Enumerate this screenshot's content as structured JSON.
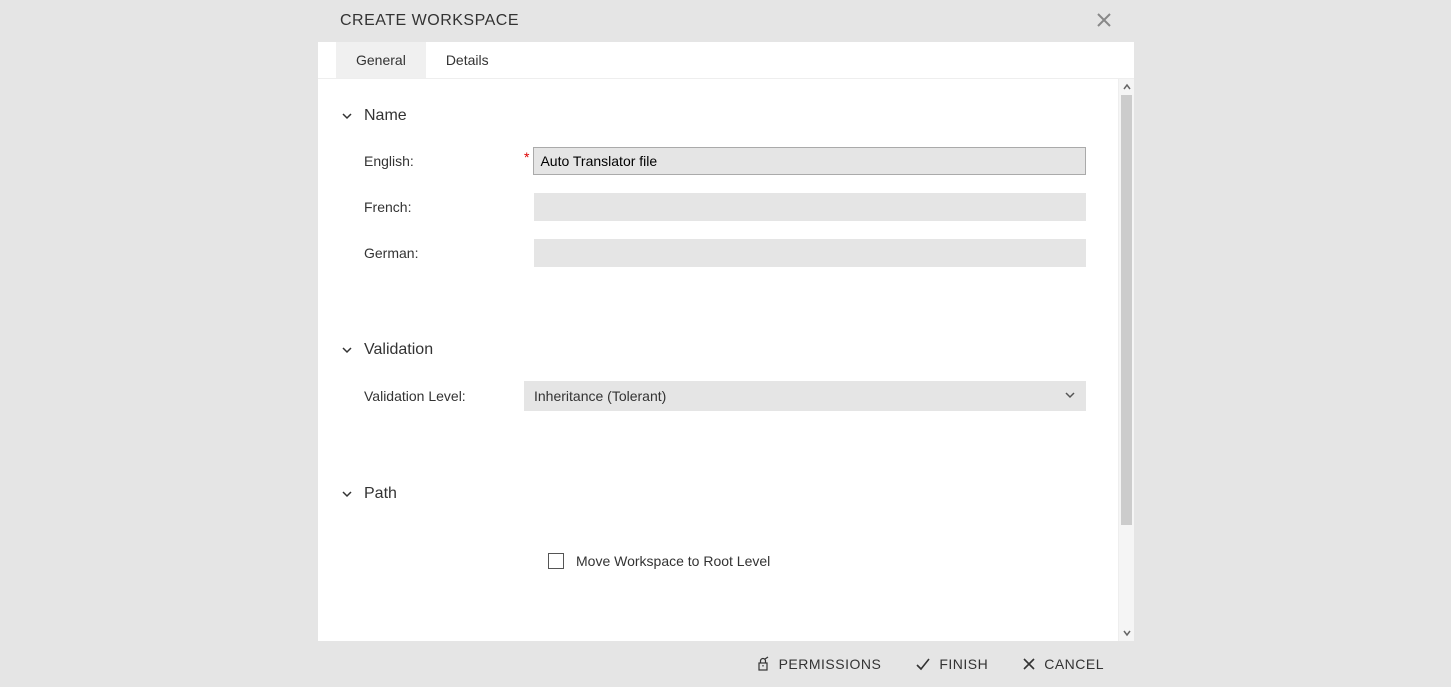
{
  "dialog": {
    "title": "CREATE WORKSPACE"
  },
  "tabs": {
    "general": "General",
    "details": "Details"
  },
  "sections": {
    "name": {
      "title": "Name",
      "fields": {
        "english": {
          "label": "English:",
          "value": "Auto Translator file",
          "required": true
        },
        "french": {
          "label": "French:",
          "value": ""
        },
        "german": {
          "label": "German:",
          "value": ""
        }
      }
    },
    "validation": {
      "title": "Validation",
      "level_label": "Validation Level:",
      "level_value": "Inheritance (Tolerant)"
    },
    "path": {
      "title": "Path",
      "move_root_label": "Move Workspace to Root Level",
      "move_root_checked": false
    }
  },
  "footer": {
    "permissions": "PERMISSIONS",
    "finish": "FINISH",
    "cancel": "CANCEL"
  }
}
